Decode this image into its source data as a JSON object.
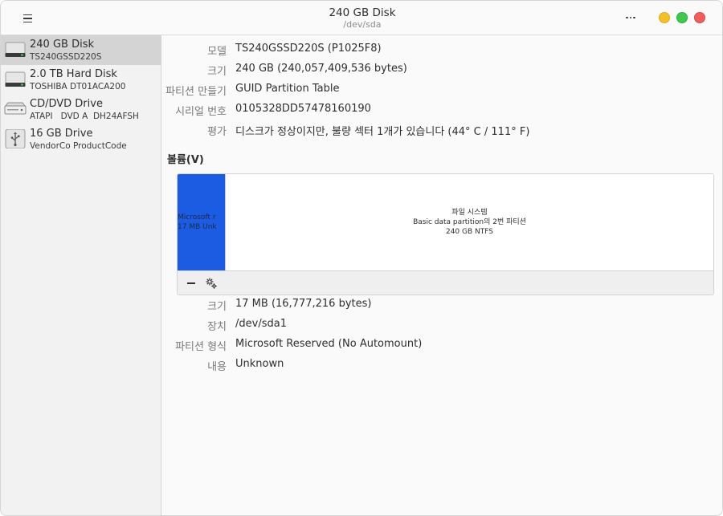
{
  "header": {
    "title": "240 GB Disk",
    "subtitle": "/dev/sda"
  },
  "icons": {
    "menu": "hamburger-menu-icon",
    "more": "more-options-icon",
    "settings": "gears-icon",
    "remove": "minus-icon"
  },
  "colors": {
    "accent_partition": "#1c5ce3",
    "selected_row": "#d4d4d4",
    "minimize": "#f5c027",
    "maximize": "#3ec94c",
    "close": "#f15d5b"
  },
  "sidebar": {
    "drives": [
      {
        "name": "240 GB Disk",
        "model": "TS240GSSD220S",
        "icon": "hard-disk-icon",
        "selected": true
      },
      {
        "name": "2.0 TB Hard Disk",
        "model": "TOSHIBA DT01ACA200",
        "icon": "hard-disk-icon",
        "selected": false
      },
      {
        "name": "CD/DVD Drive",
        "model": "ATAPI   DVD A  DH24AFSH",
        "icon": "optical-drive-icon",
        "selected": false
      },
      {
        "name": "16 GB Drive",
        "model": "VendorCo ProductCode",
        "icon": "usb-drive-icon",
        "selected": false
      }
    ]
  },
  "disk_info": {
    "model_label": "모델",
    "model_value": "TS240GSSD220S (P1025F8)",
    "size_label": "크기",
    "size_value": "240 GB (240,057,409,536 bytes)",
    "partitioning_label": "파티션 만들기",
    "partitioning_value": "GUID Partition Table",
    "serial_label": "시리얼 번호",
    "serial_value": "0105328DD57478160190",
    "assessment_label": "평가",
    "assessment_value": "디스크가 정상이지만, 불량 섹터 1개가 있습니다 (44° C / 111° F)"
  },
  "volumes": {
    "title": "볼륨(V)",
    "partition_a": {
      "line1": "Microsoft r",
      "line2": "17 MB Unk"
    },
    "partition_b": {
      "line1": "파일 시스템",
      "line2": "Basic data partition의 2번 파티션",
      "line3": "240 GB NTFS"
    }
  },
  "partition_info": {
    "size_label": "크기",
    "size_value": "17 MB (16,777,216 bytes)",
    "device_label": "장치",
    "device_value": "/dev/sda1",
    "type_label": "파티션 형식",
    "type_value": "Microsoft Reserved (No Automount)",
    "contents_label": "내용",
    "contents_value": "Unknown"
  }
}
